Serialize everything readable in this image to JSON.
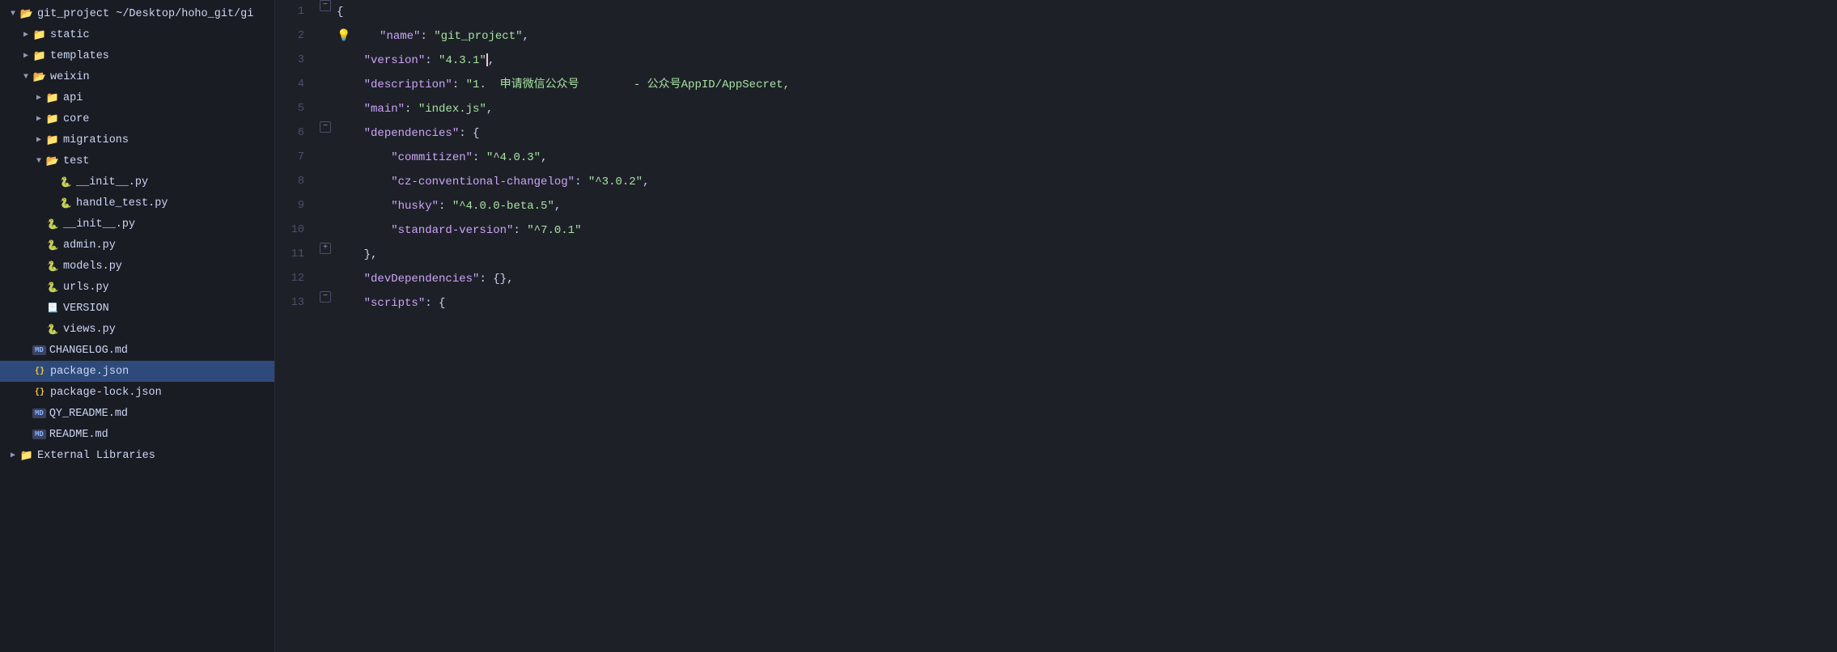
{
  "sidebar": {
    "items": [
      {
        "id": "git_project",
        "label": "git_project  ~/Desktop/hoho_git/gi",
        "level": 0,
        "type": "folder-open",
        "state": "open",
        "selected": false
      },
      {
        "id": "static",
        "label": "static",
        "level": 1,
        "type": "folder",
        "state": "closed",
        "selected": false
      },
      {
        "id": "templates",
        "label": "templates",
        "level": 1,
        "type": "folder",
        "state": "closed",
        "selected": false
      },
      {
        "id": "weixin",
        "label": "weixin",
        "level": 1,
        "type": "folder-open",
        "state": "open",
        "selected": false
      },
      {
        "id": "api",
        "label": "api",
        "level": 2,
        "type": "folder",
        "state": "closed",
        "selected": false
      },
      {
        "id": "core",
        "label": "core",
        "level": 2,
        "type": "folder",
        "state": "closed",
        "selected": false
      },
      {
        "id": "migrations",
        "label": "migrations",
        "level": 2,
        "type": "folder",
        "state": "closed",
        "selected": false
      },
      {
        "id": "test",
        "label": "test",
        "level": 2,
        "type": "folder-open",
        "state": "open",
        "selected": false
      },
      {
        "id": "__init__py_test",
        "label": "__init__.py",
        "level": 3,
        "type": "py",
        "state": "",
        "selected": false
      },
      {
        "id": "handle_test_py",
        "label": "handle_test.py",
        "level": 3,
        "type": "py",
        "state": "",
        "selected": false
      },
      {
        "id": "__init__py",
        "label": "__init__.py",
        "level": 2,
        "type": "py",
        "state": "",
        "selected": false
      },
      {
        "id": "admin_py",
        "label": "admin.py",
        "level": 2,
        "type": "py",
        "state": "",
        "selected": false
      },
      {
        "id": "models_py",
        "label": "models.py",
        "level": 2,
        "type": "py",
        "state": "",
        "selected": false
      },
      {
        "id": "urls_py",
        "label": "urls.py",
        "level": 2,
        "type": "py",
        "state": "",
        "selected": false
      },
      {
        "id": "VERSION",
        "label": "VERSION",
        "level": 2,
        "type": "txt",
        "state": "",
        "selected": false
      },
      {
        "id": "views_py",
        "label": "views.py",
        "level": 2,
        "type": "py",
        "state": "",
        "selected": false
      },
      {
        "id": "CHANGELOG_md",
        "label": "CHANGELOG.md",
        "level": 1,
        "type": "md",
        "state": "",
        "selected": false
      },
      {
        "id": "package_json",
        "label": "package.json",
        "level": 1,
        "type": "json",
        "state": "",
        "selected": true
      },
      {
        "id": "package_lock_json",
        "label": "package-lock.json",
        "level": 1,
        "type": "json",
        "state": "",
        "selected": false
      },
      {
        "id": "QY_README_md",
        "label": "QY_README.md",
        "level": 1,
        "type": "md",
        "state": "",
        "selected": false
      },
      {
        "id": "README_md",
        "label": "README.md",
        "level": 1,
        "type": "md",
        "state": "",
        "selected": false
      },
      {
        "id": "External_Libraries",
        "label": "External Libraries",
        "level": 0,
        "type": "folder",
        "state": "closed",
        "selected": false
      }
    ]
  },
  "editor": {
    "lines": [
      {
        "num": 1,
        "fold": "open",
        "content": [
          {
            "type": "brace",
            "text": "{"
          }
        ]
      },
      {
        "num": 2,
        "fold": "",
        "lightbulb": true,
        "content": [
          {
            "type": "indent",
            "text": "    "
          },
          {
            "type": "key",
            "text": "\"name\""
          },
          {
            "type": "colon",
            "text": ": "
          },
          {
            "type": "string",
            "text": "\"git_project\""
          },
          {
            "type": "comma",
            "text": ","
          }
        ]
      },
      {
        "num": 3,
        "fold": "",
        "content": [
          {
            "type": "indent",
            "text": "    "
          },
          {
            "type": "key",
            "text": "\"version\""
          },
          {
            "type": "colon",
            "text": ": "
          },
          {
            "type": "string",
            "text": "\"4.3.1\""
          },
          {
            "type": "cursor",
            "text": ""
          },
          {
            "type": "comma",
            "text": ","
          }
        ]
      },
      {
        "num": 4,
        "fold": "",
        "content": [
          {
            "type": "indent",
            "text": "    "
          },
          {
            "type": "key",
            "text": "\"description\""
          },
          {
            "type": "colon",
            "text": ": "
          },
          {
            "type": "string",
            "text": "\"1.  申请微信公众号        - 公众号AppID/AppSecret,"
          }
        ]
      },
      {
        "num": 5,
        "fold": "",
        "content": [
          {
            "type": "indent",
            "text": "    "
          },
          {
            "type": "key",
            "text": "\"main\""
          },
          {
            "type": "colon",
            "text": ": "
          },
          {
            "type": "string",
            "text": "\"index.js\""
          },
          {
            "type": "comma",
            "text": ","
          }
        ]
      },
      {
        "num": 6,
        "fold": "open",
        "content": [
          {
            "type": "indent",
            "text": "    "
          },
          {
            "type": "key",
            "text": "\"dependencies\""
          },
          {
            "type": "colon",
            "text": ": "
          },
          {
            "type": "brace",
            "text": "{"
          }
        ]
      },
      {
        "num": 7,
        "fold": "",
        "content": [
          {
            "type": "indent",
            "text": "        "
          },
          {
            "type": "key",
            "text": "\"commitizen\""
          },
          {
            "type": "colon",
            "text": ": "
          },
          {
            "type": "string",
            "text": "\"^4.0.3\""
          },
          {
            "type": "comma",
            "text": ","
          }
        ]
      },
      {
        "num": 8,
        "fold": "",
        "content": [
          {
            "type": "indent",
            "text": "        "
          },
          {
            "type": "key",
            "text": "\"cz-conventional-changelog\""
          },
          {
            "type": "colon",
            "text": ": "
          },
          {
            "type": "string",
            "text": "\"^3.0.2\""
          },
          {
            "type": "comma",
            "text": ","
          }
        ]
      },
      {
        "num": 9,
        "fold": "",
        "content": [
          {
            "type": "indent",
            "text": "        "
          },
          {
            "type": "key",
            "text": "\"husky\""
          },
          {
            "type": "colon",
            "text": ": "
          },
          {
            "type": "string",
            "text": "\"^4.0.0-beta.5\""
          },
          {
            "type": "comma",
            "text": ","
          }
        ]
      },
      {
        "num": 10,
        "fold": "",
        "content": [
          {
            "type": "indent",
            "text": "        "
          },
          {
            "type": "key",
            "text": "\"standard-version\""
          },
          {
            "type": "colon",
            "text": ": "
          },
          {
            "type": "string",
            "text": "\"^7.0.1\""
          }
        ]
      },
      {
        "num": 11,
        "fold": "close",
        "content": [
          {
            "type": "indent",
            "text": "    "
          },
          {
            "type": "brace",
            "text": "},"
          }
        ]
      },
      {
        "num": 12,
        "fold": "",
        "content": [
          {
            "type": "indent",
            "text": "    "
          },
          {
            "type": "key",
            "text": "\"devDependencies\""
          },
          {
            "type": "colon",
            "text": ": "
          },
          {
            "type": "brace",
            "text": "{}"
          },
          {
            "type": "comma",
            "text": ","
          }
        ]
      },
      {
        "num": 13,
        "fold": "open",
        "content": [
          {
            "type": "indent",
            "text": "    "
          },
          {
            "type": "key",
            "text": "\"scripts\""
          },
          {
            "type": "colon",
            "text": ": "
          },
          {
            "type": "brace",
            "text": "{"
          }
        ]
      }
    ]
  },
  "colors": {
    "bg": "#1e2028",
    "sidebar_bg": "#1a1c24",
    "selected_bg": "#2d4a7a",
    "key_color": "#cba6f7",
    "string_color": "#a6e3a1",
    "brace_color": "#cdd6f4",
    "line_num_color": "#4a5068"
  }
}
